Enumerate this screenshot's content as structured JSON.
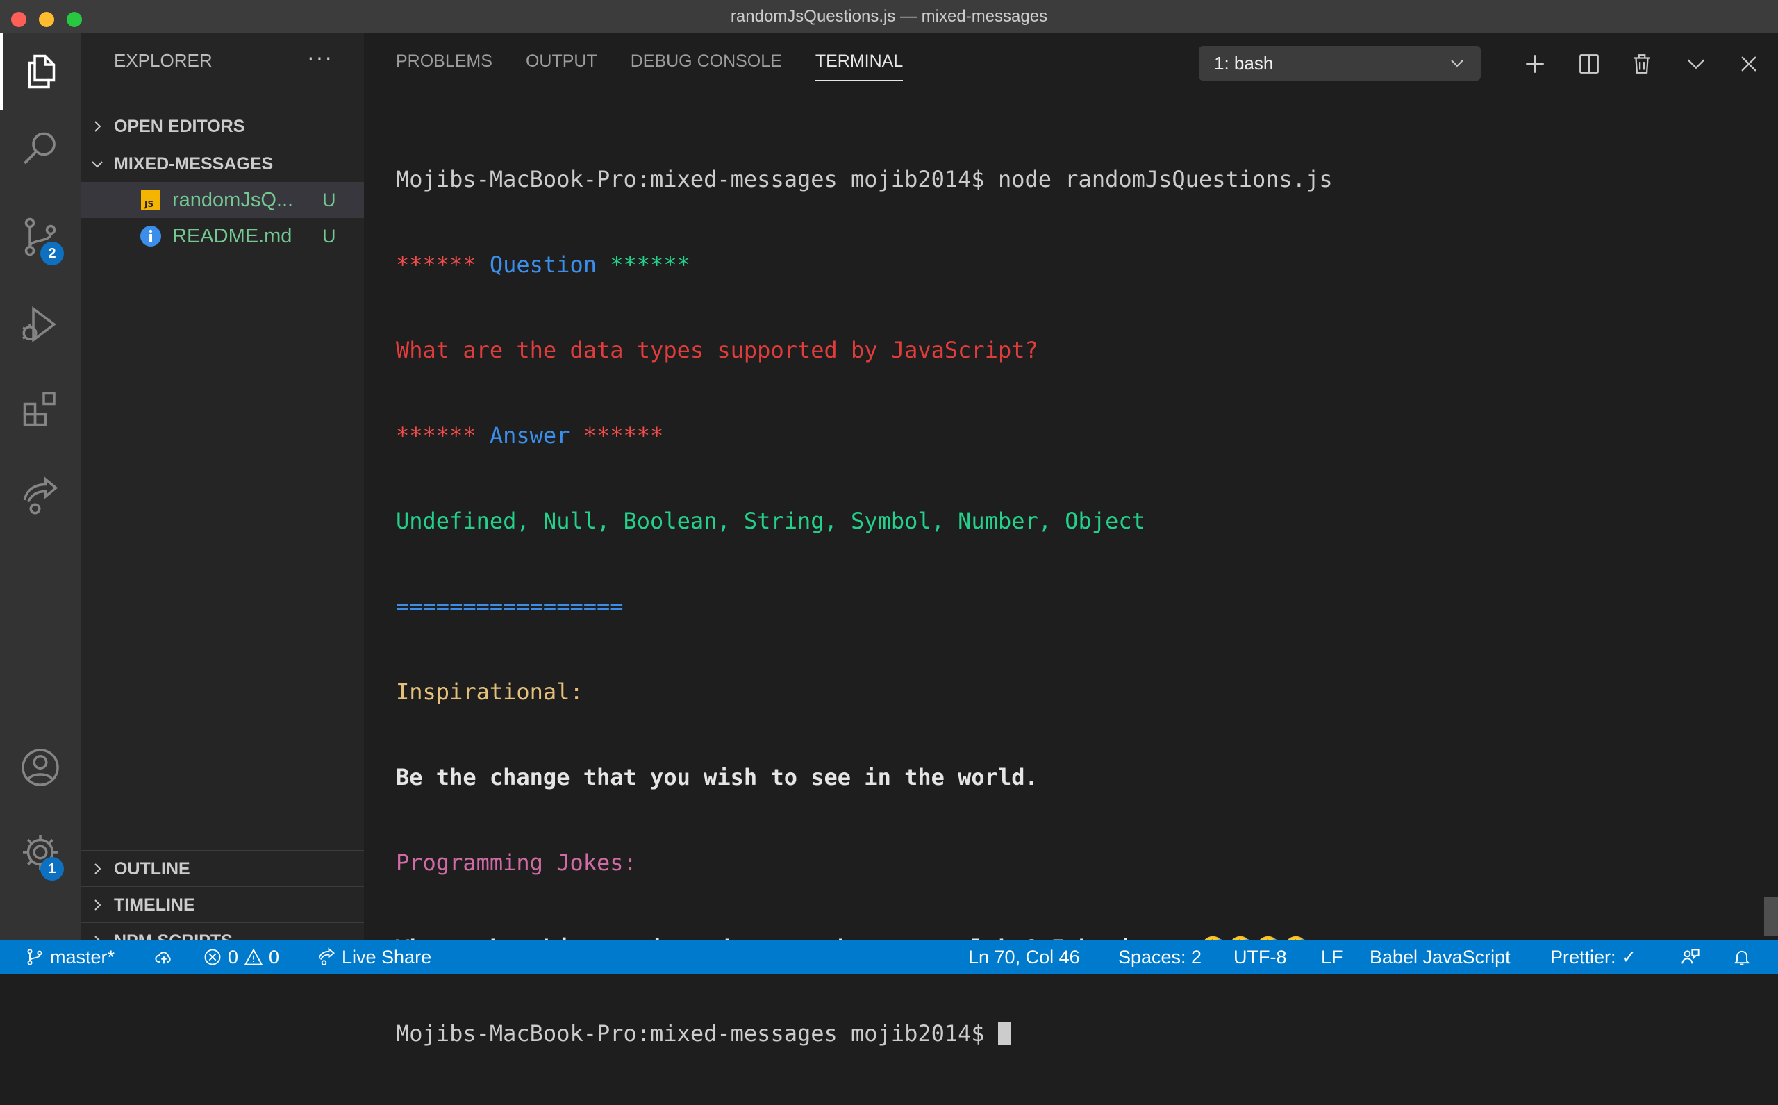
{
  "window": {
    "title": "randomJsQuestions.js — mixed-messages"
  },
  "activity": {
    "scm_badge": "2",
    "settings_badge": "1"
  },
  "sidebar": {
    "header": "EXPLORER",
    "more": "···",
    "open_editors": "OPEN EDITORS",
    "project": "MIXED-MESSAGES",
    "files": [
      {
        "name": "randomJsQ...",
        "status": "U",
        "icon": "js-file-icon"
      },
      {
        "name": "README.md",
        "status": "U",
        "icon": "info-icon"
      }
    ],
    "outline": "OUTLINE",
    "timeline": "TIMELINE",
    "npm_scripts": "NPM SCRIPTS"
  },
  "panel": {
    "tabs": [
      "PROBLEMS",
      "OUTPUT",
      "DEBUG CONSOLE",
      "TERMINAL"
    ],
    "active_tab": "TERMINAL",
    "terminal_select": "1: bash",
    "terminal": {
      "prompt_cmd": "Mojibs-MacBook-Pro:mixed-messages mojib2014$ node randomJsQuestions.js",
      "q_stars_l": "******",
      "q_label": " Question ",
      "q_stars_r": "******",
      "question": "What are the data types supported by JavaScript?",
      "a_stars_l": "******",
      "a_label": " Answer ",
      "a_stars_r": "******",
      "answer": "Undefined, Null, Boolean, String, Symbol, Number, Object",
      "separator": "=================",
      "insp_label": "Inspirational:",
      "insp_text": "Be the change that you wish to see in the world.",
      "jokes_label": "Programming Jokes:",
      "joke_text": "Whats the object-oriented way to become wealthy? Inheritance🤣🤣🤣🤣",
      "prompt_end": "Mojibs-MacBook-Pro:mixed-messages mojib2014$ "
    }
  },
  "status": {
    "branch": "master*",
    "errors": "0",
    "warnings": "0",
    "live_share": "Live Share",
    "position": "Ln 70, Col 46",
    "spaces": "Spaces: 2",
    "encoding": "UTF-8",
    "eol": "LF",
    "language": "Babel JavaScript",
    "prettier": "Prettier: ✓"
  },
  "colors": {
    "statusbar": "#007acc",
    "activity_bar": "#333333",
    "sidebar": "#252526",
    "editor": "#1e1e1e",
    "untracked": "#73c991"
  }
}
